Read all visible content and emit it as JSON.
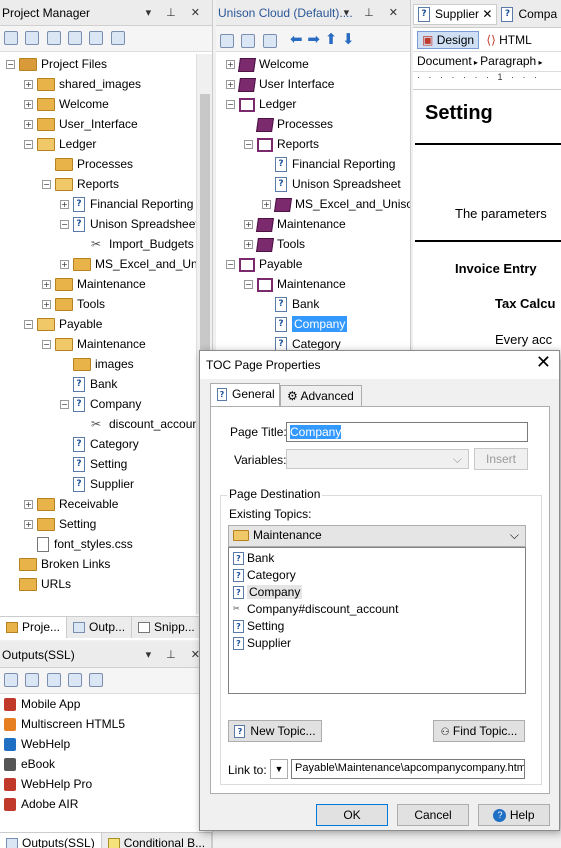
{
  "project_manager": {
    "title": "Project Manager",
    "header_controls": "▾ ⊥ ✕",
    "tree": [
      {
        "label": "Project Files",
        "indent": 0,
        "exp": "−",
        "icon": "project"
      },
      {
        "label": "shared_images",
        "indent": 1,
        "exp": "+",
        "icon": "folder"
      },
      {
        "label": "Welcome",
        "indent": 1,
        "exp": "+",
        "icon": "folder"
      },
      {
        "label": "User_Interface",
        "indent": 1,
        "exp": "+",
        "icon": "folder"
      },
      {
        "label": "Ledger",
        "indent": 1,
        "exp": "−",
        "icon": "folder-open"
      },
      {
        "label": "Processes",
        "indent": 2,
        "exp": "",
        "icon": "folder"
      },
      {
        "label": "Reports",
        "indent": 2,
        "exp": "−",
        "icon": "folder-open"
      },
      {
        "label": "Financial Reporting",
        "indent": 3,
        "exp": "+",
        "icon": "page"
      },
      {
        "label": "Unison Spreadsheet",
        "indent": 3,
        "exp": "−",
        "icon": "page"
      },
      {
        "label": "Import_Budgets",
        "indent": 4,
        "exp": "",
        "icon": "pagex"
      },
      {
        "label": "MS_Excel_and_Unis",
        "indent": 3,
        "exp": "+",
        "icon": "folder"
      },
      {
        "label": "Maintenance",
        "indent": 2,
        "exp": "+",
        "icon": "folder"
      },
      {
        "label": "Tools",
        "indent": 2,
        "exp": "+",
        "icon": "folder"
      },
      {
        "label": "Payable",
        "indent": 1,
        "exp": "−",
        "icon": "folder-open"
      },
      {
        "label": "Maintenance",
        "indent": 2,
        "exp": "−",
        "icon": "folder-open"
      },
      {
        "label": "images",
        "indent": 3,
        "exp": "",
        "icon": "folder"
      },
      {
        "label": "Bank",
        "indent": 3,
        "exp": "",
        "icon": "page"
      },
      {
        "label": "Company",
        "indent": 3,
        "exp": "−",
        "icon": "page"
      },
      {
        "label": "discount_accoun",
        "indent": 4,
        "exp": "",
        "icon": "pagex"
      },
      {
        "label": "Category",
        "indent": 3,
        "exp": "",
        "icon": "page"
      },
      {
        "label": "Setting",
        "indent": 3,
        "exp": "",
        "icon": "page"
      },
      {
        "label": "Supplier",
        "indent": 3,
        "exp": "",
        "icon": "page"
      },
      {
        "label": "Receivable",
        "indent": 1,
        "exp": "+",
        "icon": "folder"
      },
      {
        "label": "Setting",
        "indent": 1,
        "exp": "+",
        "icon": "folder"
      },
      {
        "label": "font_styles.css",
        "indent": 1,
        "exp": "",
        "icon": "css"
      },
      {
        "label": "Broken Links",
        "indent": 0,
        "exp": "",
        "icon": "folder"
      },
      {
        "label": "URLs",
        "indent": 0,
        "exp": "",
        "icon": "folder"
      }
    ],
    "tabs": [
      "Proje...",
      "Outp...",
      "Snipp..."
    ]
  },
  "outputs": {
    "title": "Outputs(SSL)",
    "header_controls": "▾ ⊥ ✕",
    "items": [
      "Mobile App",
      "Multiscreen HTML5",
      "WebHelp",
      "eBook",
      "WebHelp Pro",
      "Adobe AIR"
    ],
    "tabs": [
      "Outputs(SSL)",
      "Conditional B..."
    ]
  },
  "toc": {
    "title": "Unison Cloud (Default)....",
    "header_controls": "▾ ⊥ ✕",
    "tree": [
      {
        "label": "Welcome",
        "indent": 0,
        "exp": "+",
        "icon": "book"
      },
      {
        "label": "User Interface",
        "indent": 0,
        "exp": "+",
        "icon": "book"
      },
      {
        "label": "Ledger",
        "indent": 0,
        "exp": "−",
        "icon": "book-open"
      },
      {
        "label": "Processes",
        "indent": 1,
        "exp": "",
        "icon": "book"
      },
      {
        "label": "Reports",
        "indent": 1,
        "exp": "−",
        "icon": "book-open"
      },
      {
        "label": "Financial Reporting",
        "indent": 2,
        "exp": "",
        "icon": "page"
      },
      {
        "label": "Unison Spreadsheet",
        "indent": 2,
        "exp": "",
        "icon": "page"
      },
      {
        "label": "MS_Excel_and_Uniso",
        "indent": 2,
        "exp": "+",
        "icon": "book"
      },
      {
        "label": "Maintenance",
        "indent": 1,
        "exp": "+",
        "icon": "book"
      },
      {
        "label": "Tools",
        "indent": 1,
        "exp": "+",
        "icon": "book"
      },
      {
        "label": "Payable",
        "indent": 0,
        "exp": "−",
        "icon": "book-open"
      },
      {
        "label": "Maintenance",
        "indent": 1,
        "exp": "−",
        "icon": "book-open"
      },
      {
        "label": "Bank",
        "indent": 2,
        "exp": "",
        "icon": "page"
      },
      {
        "label": "Company",
        "indent": 2,
        "exp": "",
        "icon": "page",
        "selected": true
      },
      {
        "label": "Category",
        "indent": 2,
        "exp": "",
        "icon": "page"
      }
    ]
  },
  "editor": {
    "tabs": [
      "Supplier",
      "Compa"
    ],
    "design_label": "Design",
    "html_label": "HTML",
    "format_document": "Document",
    "format_paragraph": "Paragraph",
    "heading": "Setting",
    "line1": "The parameters",
    "line2": "Invoice Entry",
    "line3": "Tax Calcu",
    "line4": "Every acc"
  },
  "dialog": {
    "title": "TOC Page Properties",
    "close": "✕",
    "tab_general": "General",
    "tab_advanced": "Advanced",
    "page_title_label": "Page Title:",
    "page_title_value": "Company",
    "variables_label": "Variables:",
    "insert_label": "Insert",
    "destination_label": "Page Destination",
    "existing_topics_label": "Existing Topics:",
    "folder_value": "Maintenance",
    "topics": [
      "Bank",
      "Category",
      "Company",
      "Company#discount_account",
      "Setting",
      "Supplier"
    ],
    "selected_topic": "Company",
    "new_topic": "New Topic...",
    "find_topic": "Find Topic...",
    "link_to_label": "Link to:",
    "link_to_value": "Payable\\Maintenance\\apcompanycompany.htm",
    "ok": "OK",
    "cancel": "Cancel",
    "help": "Help"
  }
}
